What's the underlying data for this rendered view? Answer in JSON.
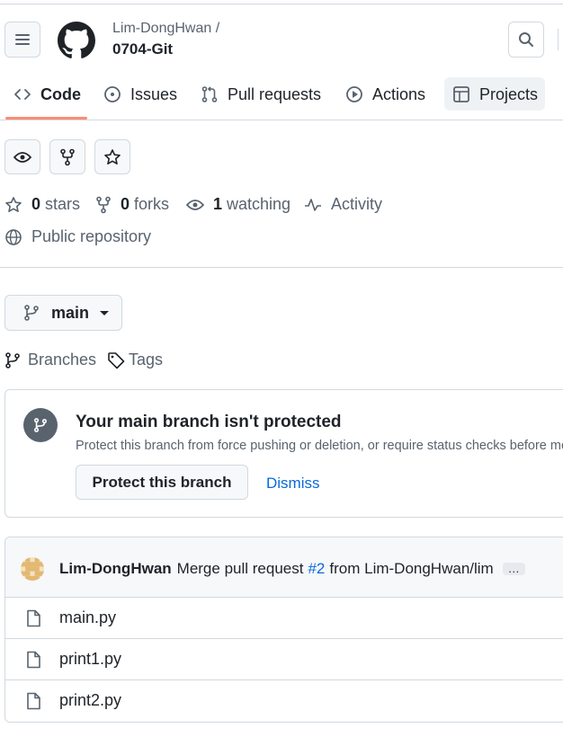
{
  "header": {
    "owner": "Lim-DongHwan /",
    "repo": "0704-Git"
  },
  "tabs": [
    {
      "label": "Code",
      "icon": "code-icon",
      "selected": true
    },
    {
      "label": "Issues",
      "icon": "issue-icon"
    },
    {
      "label": "Pull requests",
      "icon": "pull-request-icon"
    },
    {
      "label": "Actions",
      "icon": "play-icon"
    },
    {
      "label": "Projects",
      "icon": "table-icon"
    }
  ],
  "stats": {
    "stars_count": "0",
    "stars_label": "stars",
    "forks_count": "0",
    "forks_label": "forks",
    "watching_count": "1",
    "watching_label": "watching",
    "activity_label": "Activity",
    "visibility": "Public repository"
  },
  "branch": {
    "current": "main",
    "branches_label": "Branches",
    "tags_label": "Tags"
  },
  "protect_banner": {
    "title": "Your main branch isn't protected",
    "description": "Protect this branch from force pushing or deletion, or require status checks before merging.",
    "protect_button": "Protect this branch",
    "dismiss_link": "Dismiss"
  },
  "commit": {
    "author": "Lim-DongHwan",
    "message_prefix": "Merge pull request",
    "pr_number": "#2",
    "message_suffix": "from Lim-DongHwan/lim",
    "more": "…"
  },
  "files": [
    {
      "name": "main.py"
    },
    {
      "name": "print1.py"
    },
    {
      "name": "print2.py"
    }
  ],
  "colors": {
    "accent": "#fd8c73",
    "link": "#0969da",
    "border": "#d1d9e0",
    "muted": "#59636e",
    "avatar": "#e3b873"
  }
}
